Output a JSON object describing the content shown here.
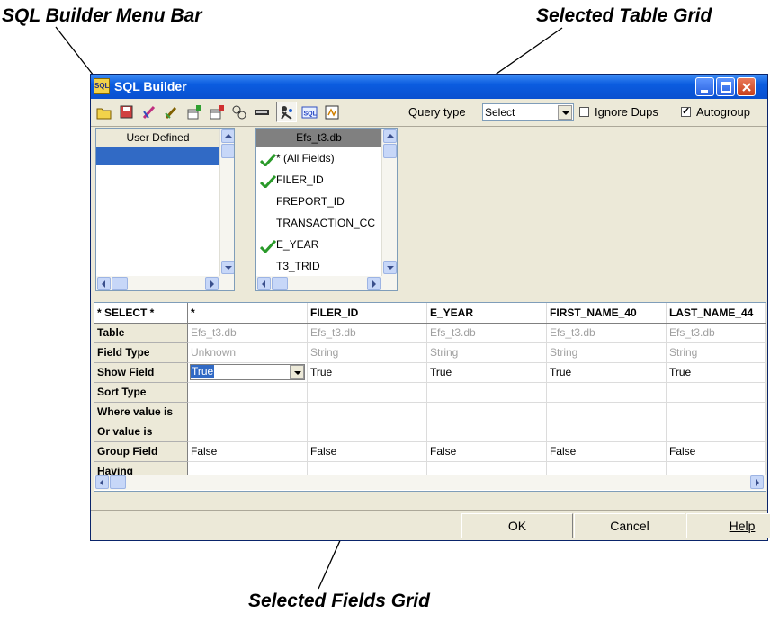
{
  "callouts": {
    "menu_bar": "SQL Builder Menu Bar",
    "table_grid": "Selected Table Grid",
    "fields_grid": "Selected Fields Grid"
  },
  "window": {
    "title": "SQL Builder",
    "icon_text": "SQL"
  },
  "toolbar": {
    "icons": [
      "open-folder-icon",
      "save-icon",
      "clear-icon",
      "edit-icon",
      "add-table-icon",
      "remove-table-icon",
      "join-icon",
      "sql-field-icon",
      "run-query-icon",
      "sql-text-icon",
      "report-icon"
    ],
    "query_type_label": "Query type",
    "query_type_value": "Select",
    "ignore_dups_label": "Ignore Dups",
    "ignore_dups_checked": false,
    "autogroup_label": "Autogroup",
    "autogroup_checked": true
  },
  "user_defined_list": {
    "header": "User Defined"
  },
  "table_list": {
    "header": "Efs_t3.db",
    "fields": [
      {
        "name": "* (All Fields)",
        "checked": true
      },
      {
        "name": "FILER_ID",
        "checked": true
      },
      {
        "name": "FREPORT_ID",
        "checked": false
      },
      {
        "name": "TRANSACTION_CC",
        "checked": false
      },
      {
        "name": "E_YEAR",
        "checked": true
      },
      {
        "name": "T3_TRID",
        "checked": false
      }
    ]
  },
  "fields_grid": {
    "corner": "* SELECT *",
    "columns": [
      "*",
      "FILER_ID",
      "E_YEAR",
      "FIRST_NAME_40",
      "LAST_NAME_44"
    ],
    "rows": [
      {
        "label": "Table",
        "values": [
          "Efs_t3.db",
          "Efs_t3.db",
          "Efs_t3.db",
          "Efs_t3.db",
          "Efs_t3.db"
        ]
      },
      {
        "label": "Field Type",
        "values": [
          "Unknown",
          "String",
          "String",
          "String",
          "String"
        ]
      },
      {
        "label": "Show Field",
        "values": [
          "True",
          "True",
          "True",
          "True",
          "True"
        ]
      },
      {
        "label": "Sort Type",
        "values": [
          "",
          "",
          "",
          "",
          ""
        ]
      },
      {
        "label": "Where value is",
        "values": [
          "",
          "",
          "",
          "",
          ""
        ]
      },
      {
        "label": "Or value is",
        "values": [
          "",
          "",
          "",
          "",
          ""
        ]
      },
      {
        "label": "Group Field",
        "values": [
          "False",
          "False",
          "False",
          "False",
          "False"
        ]
      },
      {
        "label": "Having",
        "values": [
          "",
          "",
          "",
          "",
          ""
        ]
      }
    ]
  },
  "buttons": {
    "ok": "OK",
    "cancel": "Cancel",
    "help": "Help"
  }
}
